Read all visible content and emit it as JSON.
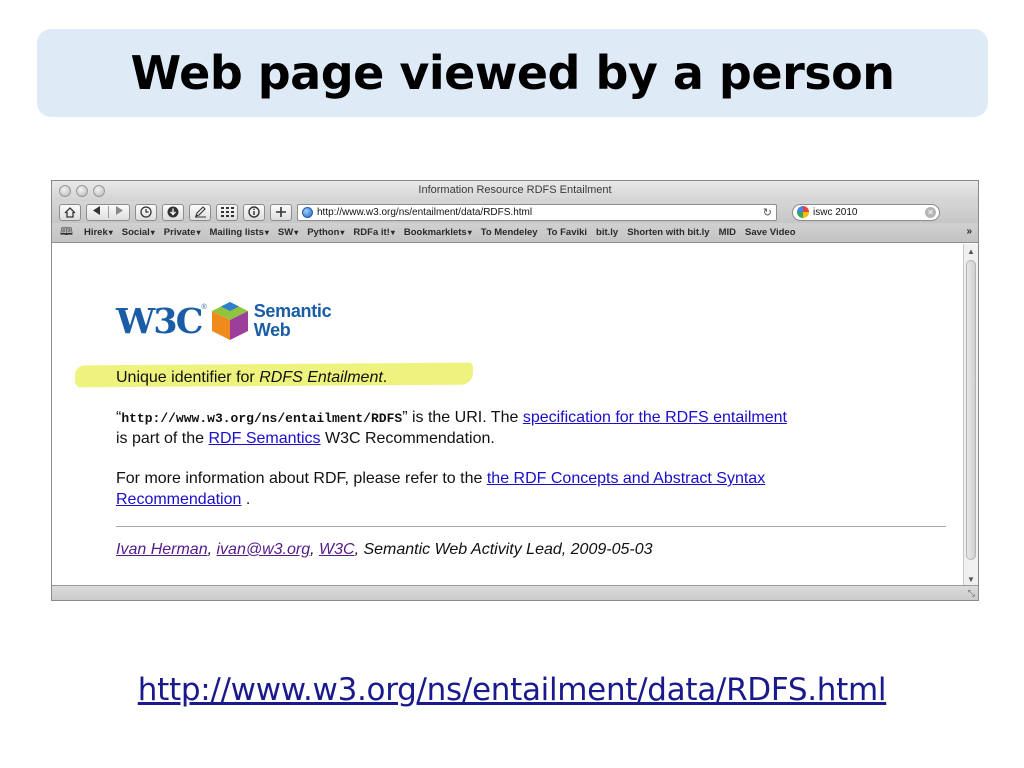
{
  "slide": {
    "title": "Web page viewed by a person",
    "caption_url": "http://www.w3.org/ns/entailment/data/RDFS.html"
  },
  "browser": {
    "window_title": "Information Resource RDFS Entailment",
    "address": "http://www.w3.org/ns/entailment/data/RDFS.html",
    "search_value": "iswc 2010",
    "toolbar_icons": [
      "home-icon",
      "back-icon",
      "forward-icon",
      "history-icon",
      "download-icon",
      "edit-icon",
      "grid-icon",
      "info-icon",
      "add-icon",
      "globe-icon",
      "reload-icon",
      "google-icon",
      "clear-icon"
    ],
    "bookmarks": [
      {
        "label": "Hirek",
        "menu": true
      },
      {
        "label": "Social",
        "menu": true
      },
      {
        "label": "Private",
        "menu": true
      },
      {
        "label": "Mailing lists",
        "menu": true
      },
      {
        "label": "SW",
        "menu": true
      },
      {
        "label": "Python",
        "menu": true
      },
      {
        "label": "RDFa it!",
        "menu": true
      },
      {
        "label": "Bookmarklets",
        "menu": true
      },
      {
        "label": "To Mendeley",
        "menu": false
      },
      {
        "label": "To Faviki",
        "menu": false
      },
      {
        "label": "bit.ly",
        "menu": false
      },
      {
        "label": "Shorten with bit.ly",
        "menu": false
      },
      {
        "label": "MID",
        "menu": false
      },
      {
        "label": "Save Video",
        "menu": false
      }
    ],
    "bookmarks_more": "»"
  },
  "page": {
    "logo_w3c": "W3C",
    "logo_reg": "®",
    "logo_semantic": "Semantic",
    "logo_web": "Web",
    "heading_prefix": "Unique identifier for ",
    "heading_italic": "RDFS Entailment",
    "heading_suffix": ".",
    "p1_open_quote": "“",
    "p1_uri": "http://www.w3.org/ns/entailment/RDFS",
    "p1_text": "” is the URI. The ",
    "p1_link": "specification for the RDFS entailment",
    "p1_line2_text": "is part of the ",
    "p1_line2_link": "RDF Semantics",
    "p1_line2_suffix": " W3C Recommendation.",
    "p2_text": "For more information about RDF, please refer to the ",
    "p2_link_a": "the RDF Concepts and Abstract Syntax",
    "p2_link_b": "Recommendation",
    "p2_suffix": " .",
    "footer_author": "Ivan Herman",
    "footer_sep1": ", ",
    "footer_email": "ivan@w3.org",
    "footer_sep2": ", ",
    "footer_org": "W3C",
    "footer_suffix": ", Semantic Web Activity Lead, 2009-05-03"
  },
  "colors": {
    "title_banner": "#deebf7",
    "link": "#1a0dcc",
    "visited_link": "#551a8b",
    "highlight": "#eef37d",
    "w3c_blue": "#1a5da6"
  }
}
